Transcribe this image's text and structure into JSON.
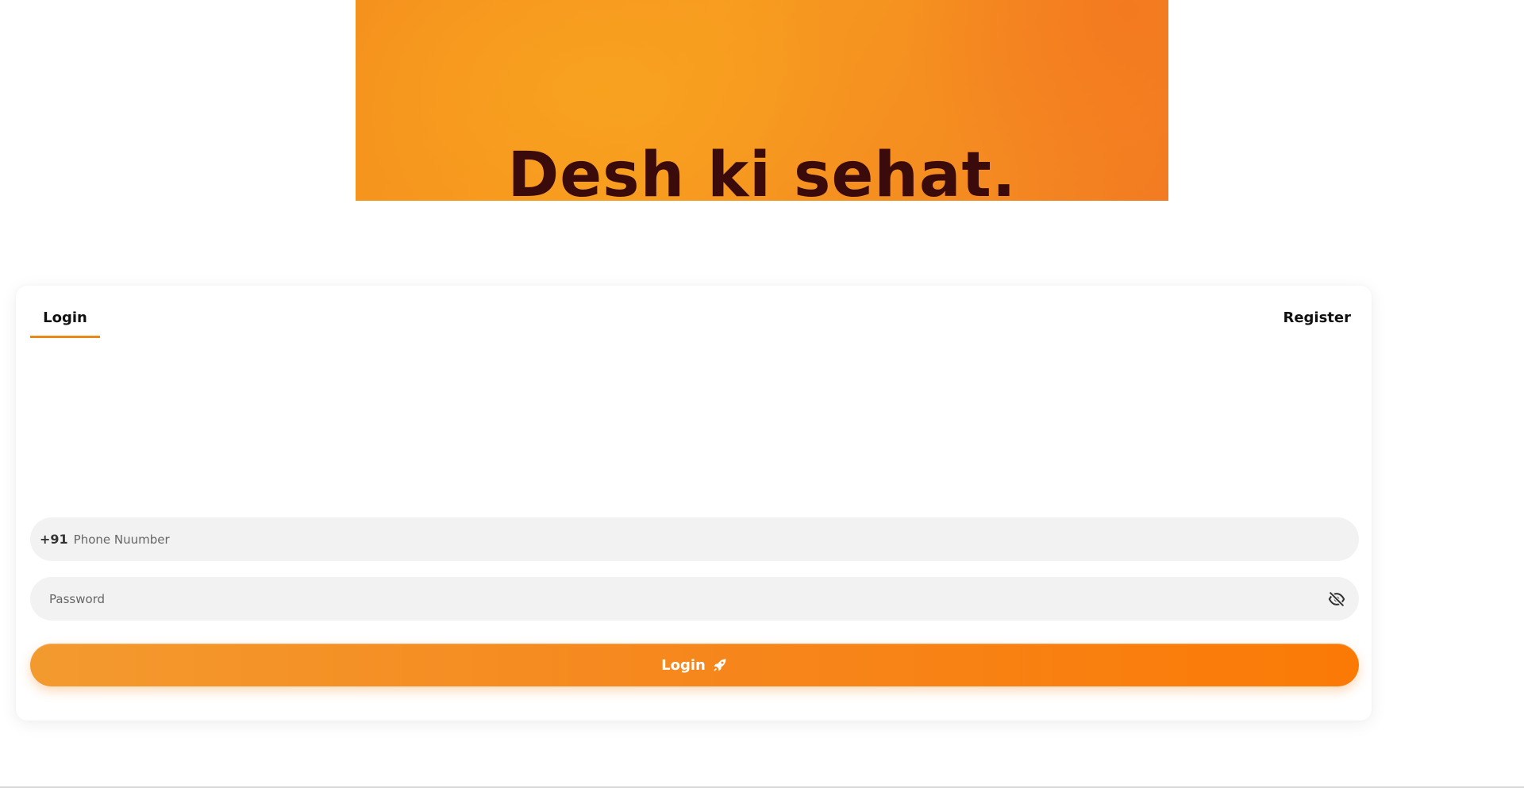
{
  "hero": {
    "text": "Desh ki sehat."
  },
  "tabs": {
    "login_label": "Login",
    "register_label": "Register"
  },
  "form": {
    "phone_prefix": "+91",
    "phone_placeholder": "Phone Nuumber",
    "phone_value": "",
    "password_placeholder": "Password",
    "password_value": "",
    "submit_label": "Login"
  },
  "icons": {
    "password_toggle": "eye-slash-icon",
    "submit": "rocket-icon"
  },
  "colors": {
    "accent": "#f5911f",
    "tab_underline": "#e8891b",
    "button_start": "#f39a2e",
    "button_end": "#fb7a06",
    "field_bg": "#f2f2f2"
  }
}
